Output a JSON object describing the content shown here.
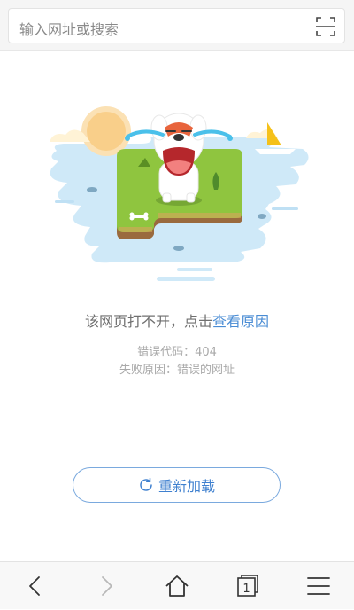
{
  "address_bar": {
    "placeholder": "输入网址或搜索",
    "scan_icon": "scan-qr-icon"
  },
  "error": {
    "message_prefix": "该网页打不开，点击",
    "message_link": "查看原因",
    "code_line": "错误代码：404",
    "reason_line": "失败原因：错误的网址"
  },
  "reload": {
    "label": "重新加载",
    "icon": "refresh-icon"
  },
  "toolbar": {
    "tab_count": "1",
    "items": [
      "back-icon",
      "forward-icon",
      "home-icon",
      "tabs-icon",
      "menu-icon"
    ]
  },
  "colors": {
    "link": "#4a8cd4",
    "reload_text": "#3f80cf",
    "reload_border": "#7aa9de"
  }
}
